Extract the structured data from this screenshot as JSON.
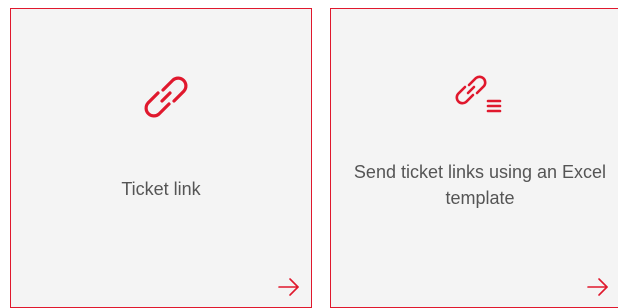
{
  "accent_color": "#e0182d",
  "cards": [
    {
      "label": "Ticket link",
      "icon": "link-icon",
      "action_icon": "arrow-right-icon"
    },
    {
      "label": "Send ticket links using an Excel template",
      "icon": "link-list-icon",
      "action_icon": "arrow-right-icon"
    }
  ]
}
